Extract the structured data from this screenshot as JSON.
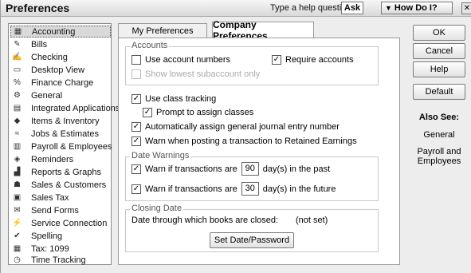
{
  "window": {
    "title": "Preferences",
    "help_question": "Type a help question",
    "ask_label": "Ask",
    "howdoi_label": "How Do I?",
    "close_label": "X"
  },
  "sidebar": {
    "items": [
      {
        "label": "Accounting",
        "icon": "accounting-icon",
        "selected": true
      },
      {
        "label": "Bills",
        "icon": "bills-icon"
      },
      {
        "label": "Checking",
        "icon": "checking-icon"
      },
      {
        "label": "Desktop View",
        "icon": "desktop-view-icon"
      },
      {
        "label": "Finance Charge",
        "icon": "finance-charge-icon"
      },
      {
        "label": "General",
        "icon": "general-icon"
      },
      {
        "label": "Integrated Applications",
        "icon": "integrated-apps-icon"
      },
      {
        "label": "Items & Inventory",
        "icon": "items-inventory-icon"
      },
      {
        "label": "Jobs & Estimates",
        "icon": "jobs-estimates-icon"
      },
      {
        "label": "Payroll & Employees",
        "icon": "payroll-icon"
      },
      {
        "label": "Reminders",
        "icon": "reminders-icon"
      },
      {
        "label": "Reports & Graphs",
        "icon": "reports-graphs-icon"
      },
      {
        "label": "Sales & Customers",
        "icon": "sales-customers-icon"
      },
      {
        "label": "Sales Tax",
        "icon": "sales-tax-icon"
      },
      {
        "label": "Send Forms",
        "icon": "send-forms-icon"
      },
      {
        "label": "Service Connection",
        "icon": "service-connection-icon"
      },
      {
        "label": "Spelling",
        "icon": "spelling-icon"
      },
      {
        "label": "Tax: 1099",
        "icon": "tax-1099-icon"
      },
      {
        "label": "Time Tracking",
        "icon": "time-tracking-icon"
      }
    ]
  },
  "tabs": {
    "my_prefs": "My Preferences",
    "company_prefs": "Company Preferences"
  },
  "accounts": {
    "group_label": "Accounts",
    "use_numbers": "Use account numbers",
    "use_numbers_checked": false,
    "require_accounts": "Require accounts",
    "require_accounts_checked": true,
    "show_lowest": "Show lowest subaccount only",
    "show_lowest_checked": false
  },
  "classes": {
    "use_class": "Use class tracking",
    "use_class_checked": true,
    "prompt_assign": "Prompt to assign classes",
    "prompt_assign_checked": true
  },
  "auto_assign": "Automatically assign general journal entry number",
  "auto_assign_checked": true,
  "warn_posting": "Warn when posting a transaction to Retained Earnings",
  "warn_posting_checked": true,
  "date_warnings": {
    "group_label": "Date Warnings",
    "past_prefix": "Warn if transactions are",
    "past_value": "90",
    "past_suffix": "day(s) in the past",
    "past_checked": true,
    "future_prefix": "Warn if transactions are",
    "future_value": "30",
    "future_suffix": "day(s) in the future",
    "future_checked": true
  },
  "closing": {
    "group_label": "Closing Date",
    "desc": "Date through which books are closed:",
    "value": "(not set)",
    "set_button": "Set Date/Password"
  },
  "actions": {
    "ok": "OK",
    "cancel": "Cancel",
    "help": "Help",
    "default": "Default"
  },
  "also_see": {
    "heading": "Also See:",
    "links": [
      "General",
      "Payroll and Employees"
    ]
  }
}
